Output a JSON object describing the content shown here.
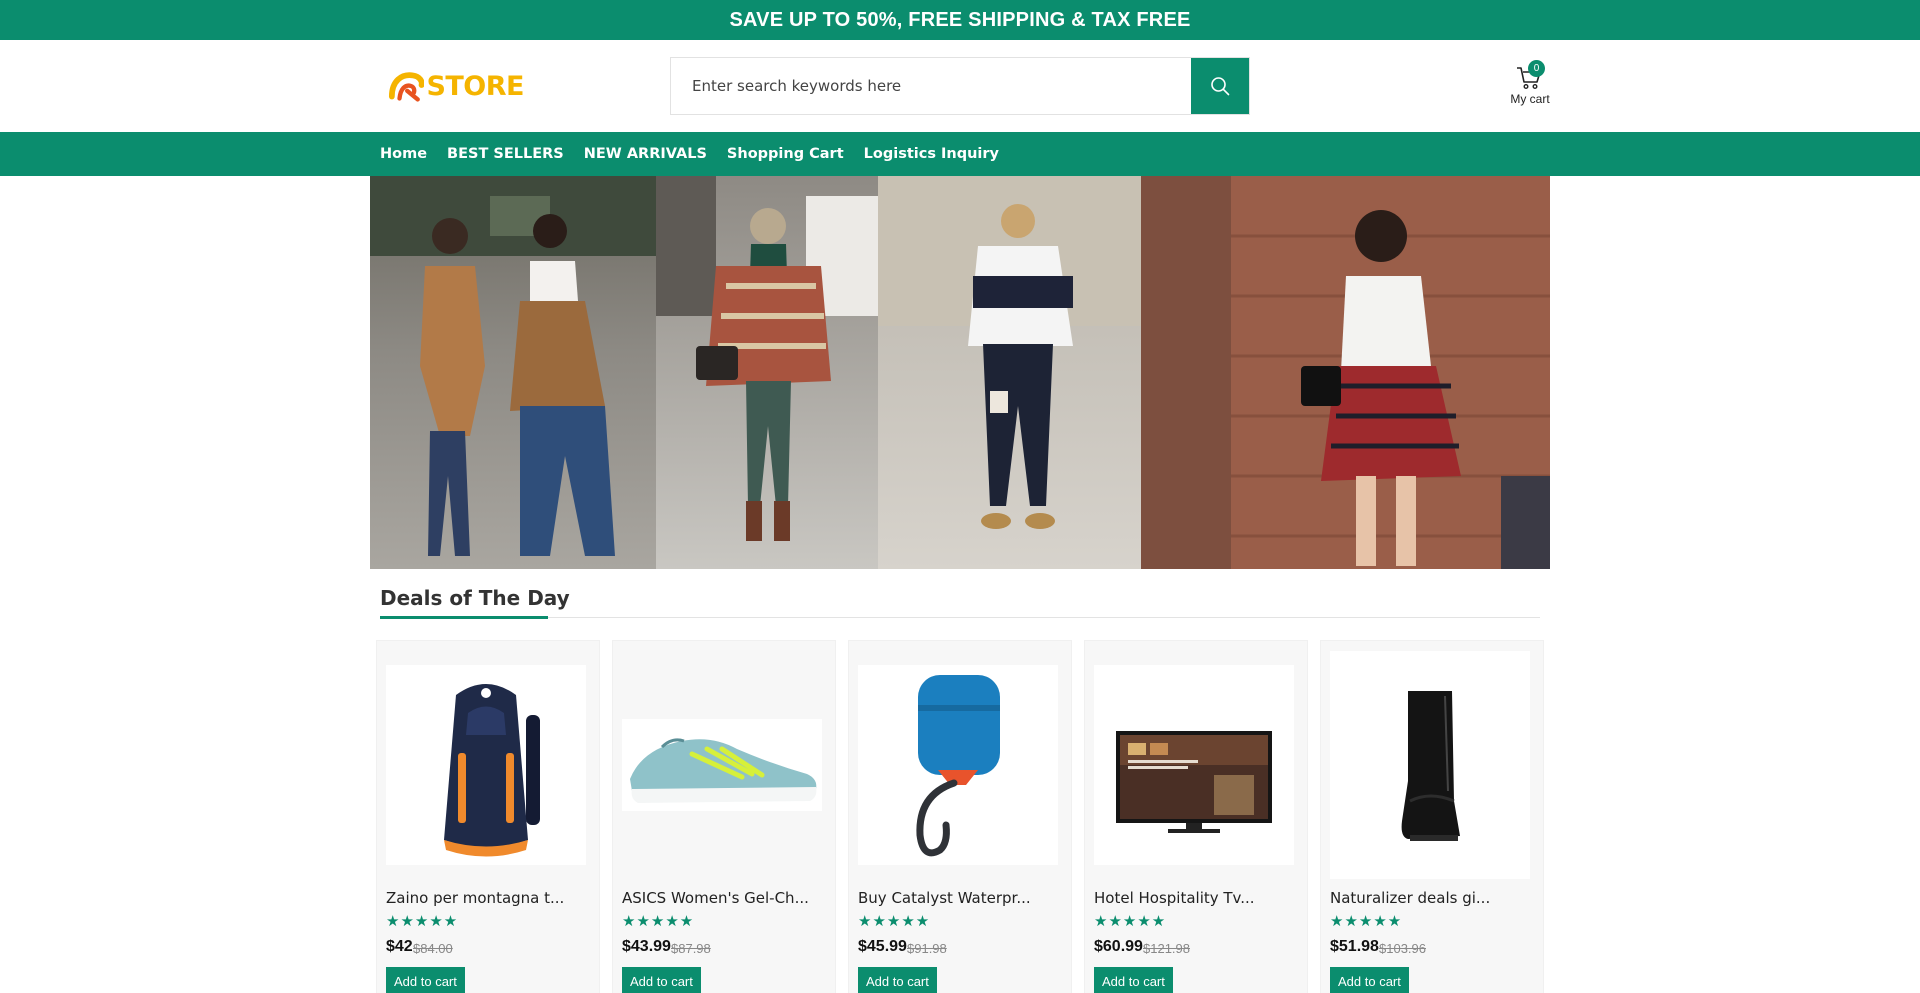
{
  "promo": {
    "text": "SAVE UP TO 50%, FREE SHIPPING & TAX FREE"
  },
  "header": {
    "logo_text": "STORE",
    "search": {
      "placeholder": "Enter search keywords here",
      "value": ""
    },
    "cart": {
      "count": "0",
      "label": "My cart"
    }
  },
  "nav": {
    "items": [
      {
        "label": "Home"
      },
      {
        "label": "BEST SELLERS"
      },
      {
        "label": "NEW ARRIVALS"
      },
      {
        "label": "Shopping Cart"
      },
      {
        "label": "Logistics Inquiry"
      }
    ]
  },
  "deals": {
    "title": "Deals of The Day",
    "products": [
      {
        "name": "Zaino per montagna t...",
        "stars": "★★★★★",
        "price": "$42",
        "old_price": "$84.00",
        "button": "Add to cart",
        "icon": "backpack-image"
      },
      {
        "name": "ASICS Women's Gel-Ch...",
        "stars": "★★★★★",
        "price": "$43.99",
        "old_price": "$87.98",
        "button": "Add to cart",
        "icon": "sneaker-image"
      },
      {
        "name": "Buy Catalyst Waterpr...",
        "stars": "★★★★★",
        "price": "$45.99",
        "old_price": "$91.98",
        "button": "Add to cart",
        "icon": "airpods-case-image"
      },
      {
        "name": "Hotel Hospitality Tv...",
        "stars": "★★★★★",
        "price": "$60.99",
        "old_price": "$121.98",
        "button": "Add to cart",
        "icon": "tv-image"
      },
      {
        "name": "Naturalizer deals gi...",
        "stars": "★★★★★",
        "price": "$51.98",
        "old_price": "$103.96",
        "button": "Add to cart",
        "icon": "ankle-boot-image"
      }
    ]
  },
  "colors": {
    "brand": "#0b8d6e",
    "logo": "#f5b400"
  }
}
